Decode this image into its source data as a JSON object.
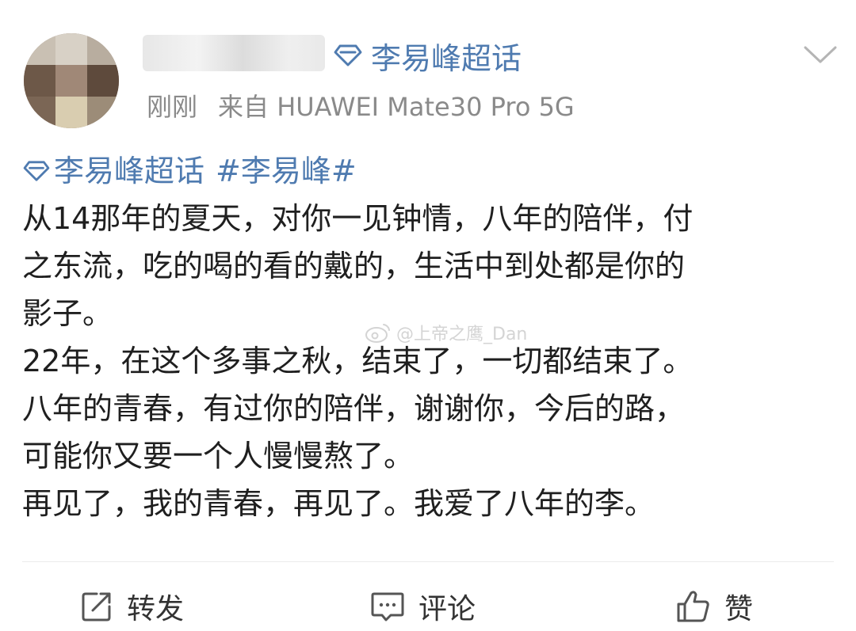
{
  "header": {
    "username": "",
    "supertopic_label": "李易峰超话",
    "time": "刚刚",
    "source": "来自 HUAWEI Mate30 Pro 5G"
  },
  "content": {
    "tags": [
      "李易峰超话",
      "#李易峰#"
    ],
    "lines": [
      "从14那年的夏天，对你一见钟情，八年的陪伴，付",
      "之东流，吃的喝的看的戴的，生活中到处都是你的",
      "影子。",
      "22年，在这个多事之秋，结束了，一切都结束了。",
      "八年的青春，有过你的陪伴，谢谢你，今后的路，",
      "可能你又要一个人慢慢熬了。",
      "再见了，我的青春，再见了。我爱了八年的李。"
    ]
  },
  "watermark": "@上帝之鹰_Dan",
  "actions": {
    "repost": "转发",
    "comment": "评论",
    "like": "赞"
  },
  "colors": {
    "link": "#4f7bb0",
    "meta": "#8a8a8a",
    "text": "#1f1f1f"
  },
  "icons": {
    "supertopic": "diamond-icon",
    "expand": "chevron-down-icon",
    "repost": "share-icon",
    "comment": "comment-icon",
    "like": "thumbs-up-icon"
  }
}
